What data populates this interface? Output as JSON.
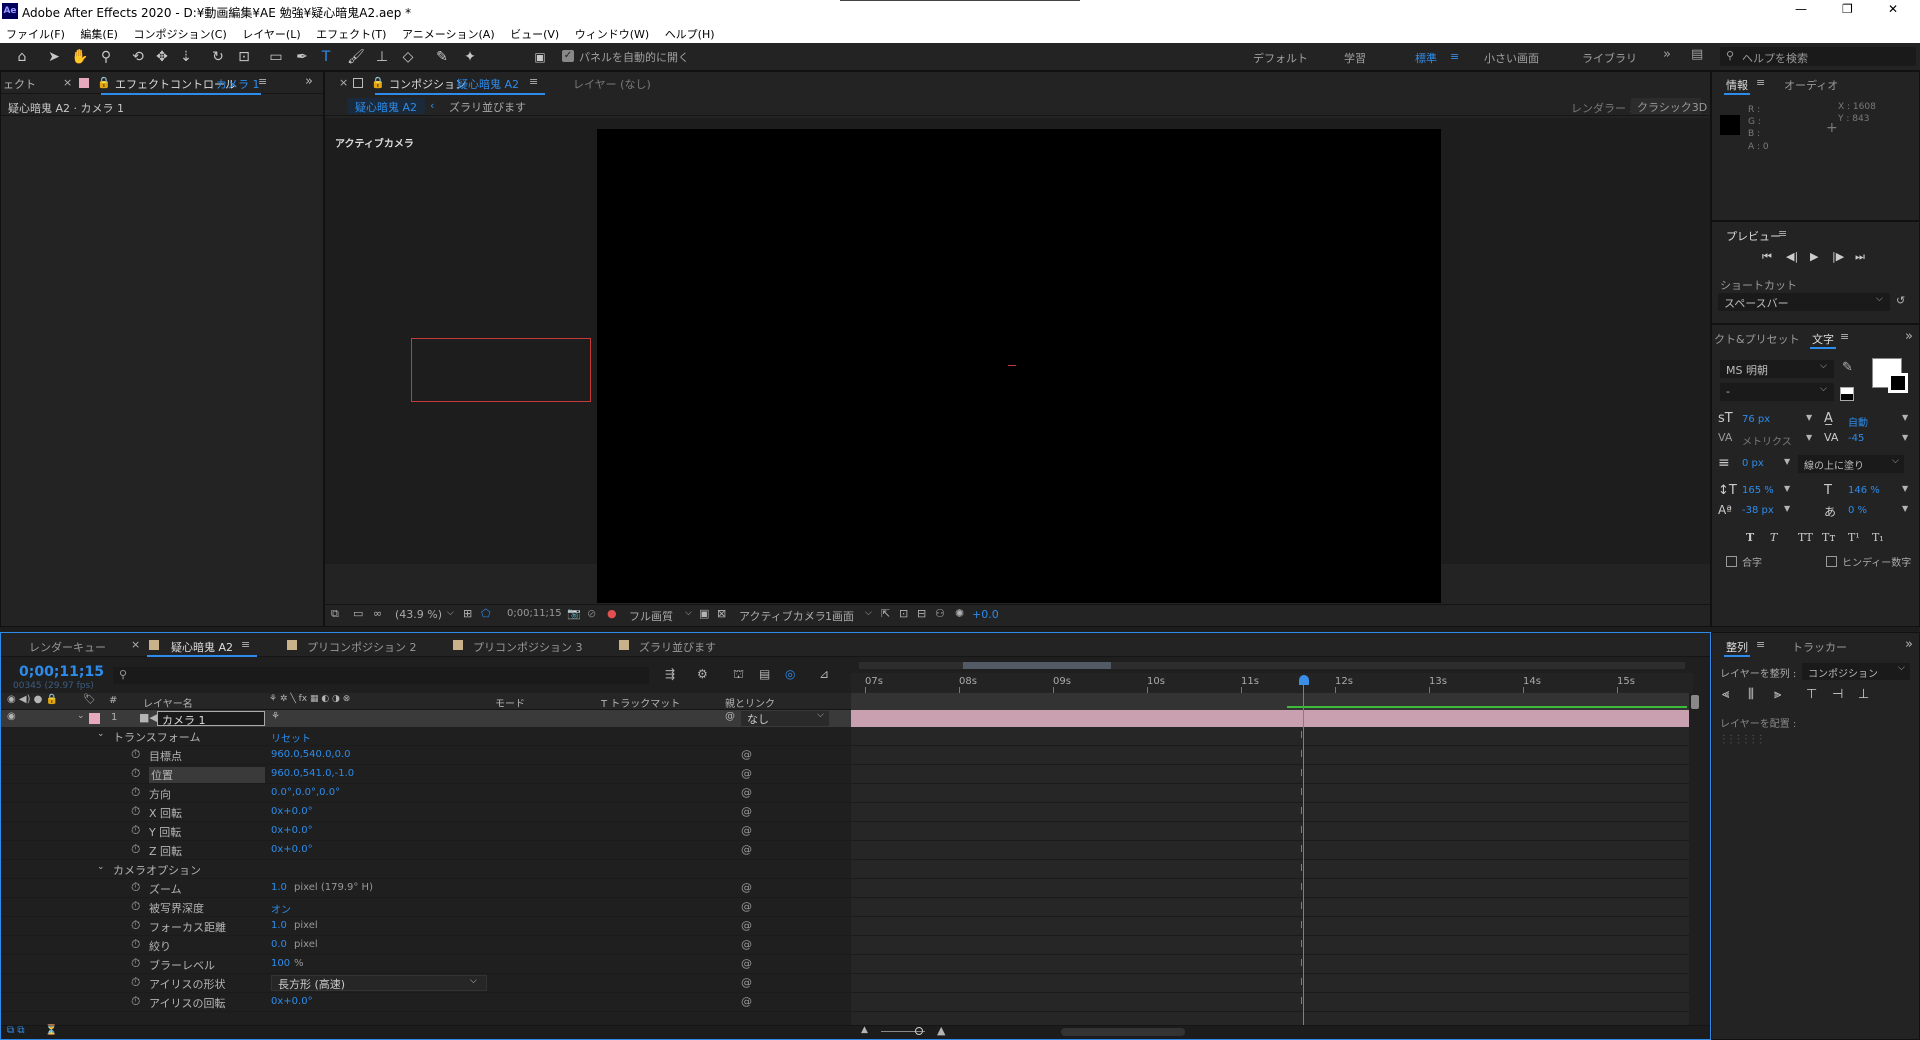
{
  "app": {
    "title": "Adobe After Effects 2020 - D:¥動画編集¥AE 勉強¥疑心暗鬼A2.aep *",
    "logo": "Ae"
  },
  "window_controls": {
    "minimize": "—",
    "maximize": "❐",
    "close": "✕"
  },
  "menu": [
    "ファイル(F)",
    "編集(E)",
    "コンポジション(C)",
    "レイヤー(L)",
    "エフェクト(T)",
    "アニメーション(A)",
    "ビュー(V)",
    "ウィンドウ(W)",
    "ヘルプ(H)"
  ],
  "toolbar": {
    "auto_open": "パネルを自動的に開く",
    "workspaces": [
      "デフォルト",
      "学習",
      "標準",
      "小さい画面",
      "ライブラリ"
    ],
    "active_workspace": "標準",
    "search_placeholder": "ヘルプを検索",
    "more": "»"
  },
  "left_panel": {
    "tab_prev": "ェクト",
    "tab_label": "エフェクトコントロール",
    "tab_target": "カメラ 1",
    "subtitle": "疑心暗鬼 A2 · カメラ 1"
  },
  "comp_panel": {
    "tab_label": "コンポジション",
    "tab_target": "疑心暗鬼 A2",
    "layer_tab": "レイヤー (なし)",
    "crumb_active": "疑心暗鬼 A2",
    "crumb_other": "ズラリ並びます",
    "renderer_label": "レンダラー :",
    "renderer_value": "クラシック3D",
    "active_camera": "アクティブカメラ"
  },
  "viewer_footer": {
    "zoom": "(43.9 %)",
    "timecode": "0;00;11;15",
    "quality": "フル画質",
    "view": "アクティブカメラ",
    "views": "1画面",
    "exposure": "+0.0"
  },
  "info_panel": {
    "tab": "情報",
    "tab2": "オーディオ",
    "r": "R :",
    "g": "G :",
    "b": "B :",
    "a": "A : 0",
    "x": "X : 1608",
    "y": "Y : 843"
  },
  "preview_panel": {
    "tab": "プレビュー",
    "shortcut_label": "ショートカット",
    "shortcut_value": "スペースバー"
  },
  "char_panel": {
    "tab_prev": "クト&プリセット",
    "tab": "文字",
    "font": "MS 明朝",
    "style": "-",
    "size": "76 px",
    "leading": "自動",
    "kerning": "メトリクス",
    "tracking": "-45",
    "stroke": "0 px",
    "stroke_mode": "線の上に塗り",
    "vscale": "165 %",
    "hscale": "146 %",
    "baseline": "-38 px",
    "tsume": "0 %",
    "styles": [
      "T",
      "T",
      "TT",
      "Tт",
      "T¹",
      "T₁"
    ],
    "ligature": "合字",
    "hindi": "ヒンディー数字"
  },
  "align_panel": {
    "tab": "整列",
    "tab2": "トラッカー",
    "align_to_label": "レイヤーを整列 :",
    "align_to_value": "コンポジション",
    "distribute_label": "レイヤーを配置 :"
  },
  "timeline": {
    "tabs": [
      "レンダーキュー",
      "疑心暗鬼 A2",
      "プリコンポジション 2",
      "プリコンポジション 3",
      "ズラリ並びます"
    ],
    "active_tab": "疑心暗鬼 A2",
    "timecode": "0;00;11;15",
    "frames": "00345 (29.97 fps)",
    "search_placeholder": "",
    "headers": {
      "num": "#",
      "layer_name": "レイヤー名",
      "mode": "モード",
      "trkmat": "T  トラックマット",
      "parent": "親とリンク"
    },
    "layer": {
      "num": "1",
      "name": "カメラ 1",
      "parent": "なし"
    },
    "ruler": [
      "07s",
      "08s",
      "09s",
      "10s",
      "11s",
      "12s",
      "13s",
      "14s",
      "15s"
    ],
    "props": [
      {
        "name": "トランスフォーム",
        "value": "リセット",
        "level": 1,
        "group": true
      },
      {
        "name": "目標点",
        "value": "960.0,540.0,0.0",
        "level": 2
      },
      {
        "name": "位置",
        "value": "960.0,541.0,-1.0",
        "level": 2,
        "selected": true
      },
      {
        "name": "方向",
        "value": "0.0°,0.0°,0.0°",
        "level": 2
      },
      {
        "name": "X 回転",
        "value": "0x+0.0°",
        "level": 2
      },
      {
        "name": "Y 回転",
        "value": "0x+0.0°",
        "level": 2
      },
      {
        "name": "Z 回転",
        "value": "0x+0.0°",
        "level": 2
      },
      {
        "name": "カメラオプション",
        "value": "",
        "level": 1,
        "group": true
      },
      {
        "name": "ズーム",
        "value": "1.0",
        "unit": " pixel (179.9° H)",
        "level": 2
      },
      {
        "name": "被写界深度",
        "value": "オン",
        "level": 2
      },
      {
        "name": "フォーカス距離",
        "value": "1.0",
        "unit": " pixel",
        "level": 2
      },
      {
        "name": "絞り",
        "value": "0.0",
        "unit": " pixel",
        "level": 2
      },
      {
        "name": "ブラーレベル",
        "value": "100",
        "unit": "%",
        "level": 2
      },
      {
        "name": "アイリスの形状",
        "value": "長方形 (高速)",
        "level": 2,
        "dropdown": true
      },
      {
        "name": "アイリスの回転",
        "value": "0x+0.0°",
        "level": 2
      }
    ]
  },
  "colors": {
    "accent": "#2d8ceb",
    "layer_bar": "#c9a0b0",
    "label_pink": "#e7a9bd",
    "playhead": "#3a8ee6",
    "camera_box": "#c43a3a"
  }
}
